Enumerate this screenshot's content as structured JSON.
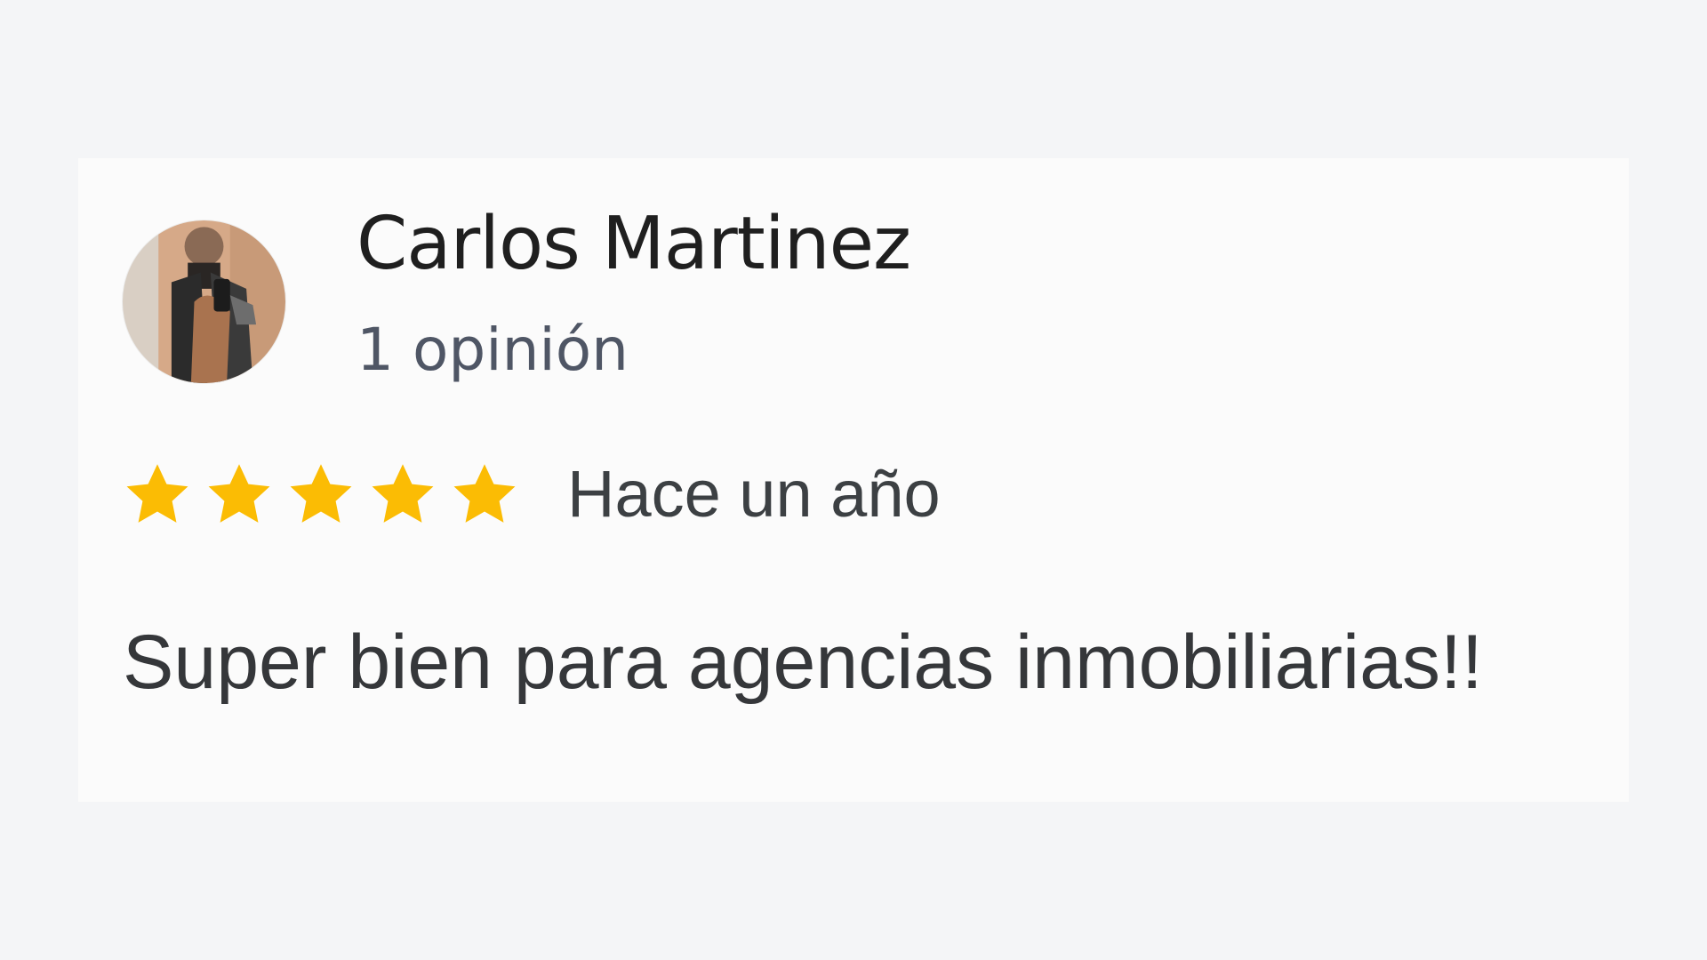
{
  "review": {
    "author_name": "Carlos Martinez",
    "review_count_label": "1 opinión",
    "rating": 5,
    "rating_max": 5,
    "date_label": "Hace un año",
    "text": "Super bien para agencias inmobiliarias!!"
  },
  "colors": {
    "star": "#fbbc04",
    "name": "#1f1f1f",
    "secondary_text": "#4f5665",
    "body_text": "#35373a",
    "card_background": "#fbfbfb",
    "page_background": "#f4f5f7"
  },
  "icons": {
    "avatar": "user-photo",
    "star": "star-icon"
  }
}
